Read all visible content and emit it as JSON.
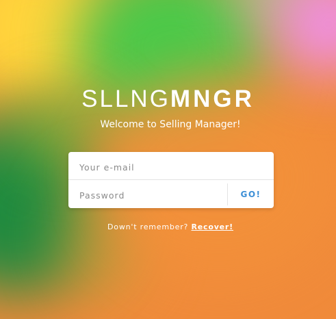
{
  "logo": {
    "light": "SLLNG",
    "bold": "MNGR"
  },
  "subtitle": "Welcome to Selling Manager!",
  "login": {
    "email_placeholder": "Your e-mail",
    "password_placeholder": "Password",
    "submit_label": "GO!"
  },
  "recover": {
    "prompt": "Down't remember? ",
    "link_label": "Recover!"
  },
  "colors": {
    "accent": "#3d8fd6",
    "background_orange": "#f08a3a",
    "background_green": "#4bc949",
    "background_yellow": "#ffd43c",
    "background_pink": "#ef8fe9"
  }
}
